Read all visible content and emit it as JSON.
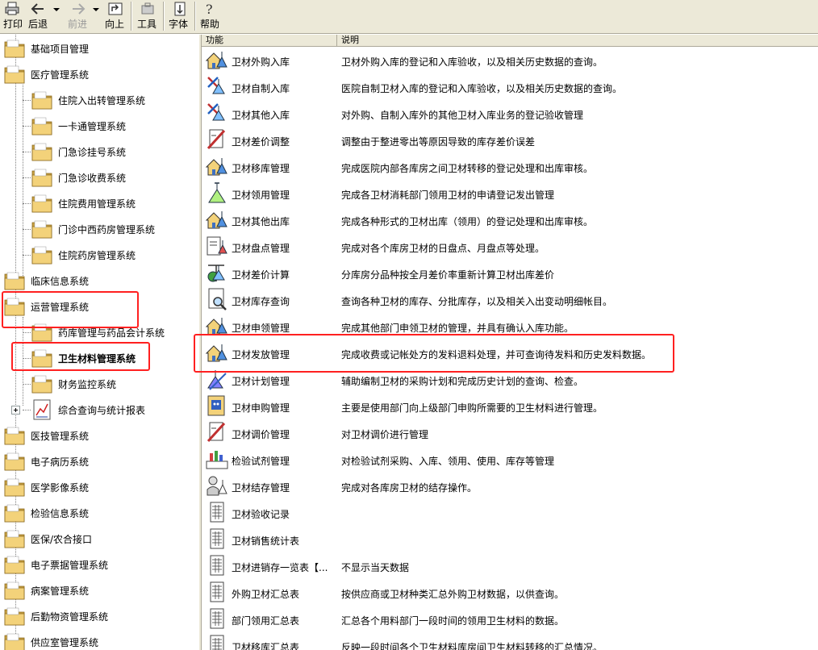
{
  "toolbar": {
    "print_label": "打印",
    "back_label": "后退",
    "forward_label": "前进",
    "up_label": "向上",
    "tools_label": "工具",
    "font_label": "字体",
    "help_label": "帮助"
  },
  "tree": {
    "items": [
      {
        "label": "基础项目管理",
        "icon": "folder-icon"
      },
      {
        "label": "医疗管理系统",
        "icon": "folder-icon"
      },
      {
        "label": "住院入出转管理系统",
        "icon": "folder-icon"
      },
      {
        "label": "一卡通管理系统",
        "icon": "folder-icon"
      },
      {
        "label": "门急诊挂号系统",
        "icon": "folder-icon"
      },
      {
        "label": "门急诊收费系统",
        "icon": "folder-icon"
      },
      {
        "label": "住院费用管理系统",
        "icon": "folder-icon"
      },
      {
        "label": "门诊中西药房管理系统",
        "icon": "folder-icon"
      },
      {
        "label": "住院药房管理系统",
        "icon": "folder-icon"
      },
      {
        "label": "临床信息系统",
        "icon": "folder-icon"
      },
      {
        "label": "运营管理系统",
        "icon": "folder-icon"
      },
      {
        "label": "药库管理与药品会计系统",
        "icon": "folder-icon"
      },
      {
        "label": "卫生材料管理系统",
        "icon": "folder-icon"
      },
      {
        "label": "财务监控系统",
        "icon": "folder-icon"
      },
      {
        "label": "综合查询与统计报表",
        "icon": "chart-report-icon"
      },
      {
        "label": "医技管理系统",
        "icon": "folder-icon"
      },
      {
        "label": "电子病历系统",
        "icon": "folder-icon"
      },
      {
        "label": "医学影像系统",
        "icon": "folder-icon"
      },
      {
        "label": "检验信息系统",
        "icon": "folder-icon"
      },
      {
        "label": "医保/农合接口",
        "icon": "folder-icon"
      },
      {
        "label": "电子票据管理系统",
        "icon": "folder-icon"
      },
      {
        "label": "病案管理系统",
        "icon": "folder-icon"
      },
      {
        "label": "后勤物资管理系统",
        "icon": "folder-icon"
      },
      {
        "label": "供应室管理系统",
        "icon": "folder-icon"
      }
    ]
  },
  "list": {
    "header_function": "功能",
    "header_description": "说明",
    "rows": [
      {
        "name": "卫材外购入库",
        "desc": "卫材外购入库的登记和入库验收，以及相关历史数据的查询。",
        "icon": "house-flask-icon"
      },
      {
        "name": "卫材自制入库",
        "desc": "医院自制卫材入库的登记和入库验收，以及相关历史数据的查询。",
        "icon": "tools-flask-icon"
      },
      {
        "name": "卫材其他入库",
        "desc": "对外购、自制入库外的其他卫材入库业务的登记验收管理",
        "icon": "tools-flask-icon"
      },
      {
        "name": "卫材差价调整",
        "desc": "调整由于整进零出等原因导致的库存差价误差",
        "icon": "pen-ruler-icon"
      },
      {
        "name": "卫材移库管理",
        "desc": "完成医院内部各库房之间卫材转移的登记处理和出库审核。",
        "icon": "house-flask-icon"
      },
      {
        "name": "卫材领用管理",
        "desc": "完成各卫材消耗部门领用卫材的申请登记发出管理",
        "icon": "flask-icon"
      },
      {
        "name": "卫材其他出库",
        "desc": "完成各种形式的卫材出库（领用）的登记处理和出库审核。",
        "icon": "house-flask-icon"
      },
      {
        "name": "卫材盘点管理",
        "desc": "完成对各个库房卫材的日盘点、月盘点等处理。",
        "icon": "clipboard-flask-icon"
      },
      {
        "name": "卫材差价计算",
        "desc": "分库房分品种按全月差价率重新计算卫材出库差价",
        "icon": "scales-flask-icon"
      },
      {
        "name": "卫材库存查询",
        "desc": "查询各种卫材的库存、分批库存，以及相关入出变动明细帐目。",
        "icon": "magnifier-document-icon"
      },
      {
        "name": "卫材申领管理",
        "desc": "完成其他部门申领卫材的管理，并具有确认入库功能。",
        "icon": "house-flask-icon"
      },
      {
        "name": "卫材发放管理",
        "desc": "完成收费或记帐处方的发料退料处理，并可查询待发料和历史发料数据。",
        "icon": "house-flask-icon"
      },
      {
        "name": "卫材计划管理",
        "desc": "辅助编制卫材的采购计划和完成历史计划的查询、检查。",
        "icon": "pen-flask-icon"
      },
      {
        "name": "卫材申购管理",
        "desc": "主要是使用部门向上级部门申购所需要的卫生材料进行管理。",
        "icon": "face-document-icon"
      },
      {
        "name": "卫材调价管理",
        "desc": "对卫材调价进行管理",
        "icon": "pen-ruler-icon"
      },
      {
        "name": "检验试剂管理",
        "desc": "对检验试剂采购、入库、领用、使用、库存等管理",
        "icon": "reagent-chart-icon"
      },
      {
        "name": "卫材结存管理",
        "desc": "完成对各库房卫材的结存操作。",
        "icon": "person-flask-icon"
      },
      {
        "name": "卫材验收记录",
        "desc": "",
        "icon": "report-grid-icon"
      },
      {
        "name": "卫材销售统计表",
        "desc": "",
        "icon": "report-grid-icon"
      },
      {
        "name": "卫材进销存一览表【...",
        "desc": "不显示当天数据",
        "icon": "report-grid-icon"
      },
      {
        "name": "外购卫材汇总表",
        "desc": "按供应商或卫材种类汇总外购卫材数据，以供查询。",
        "icon": "report-grid-icon"
      },
      {
        "name": "部门领用汇总表",
        "desc": "汇总各个用料部门一段时间的领用卫生材料的数据。",
        "icon": "report-grid-icon"
      },
      {
        "name": "卫材移库汇总表",
        "desc": "反映一段时间各个卫生材料库房间卫生材料转移的汇总情况。",
        "icon": "report-grid-icon"
      }
    ]
  },
  "colors": {
    "highlight": "#ff2020",
    "folder_body": "#f3d27a",
    "folder_dark": "#c8a040",
    "toolbar_bg": "#ece9d8"
  }
}
